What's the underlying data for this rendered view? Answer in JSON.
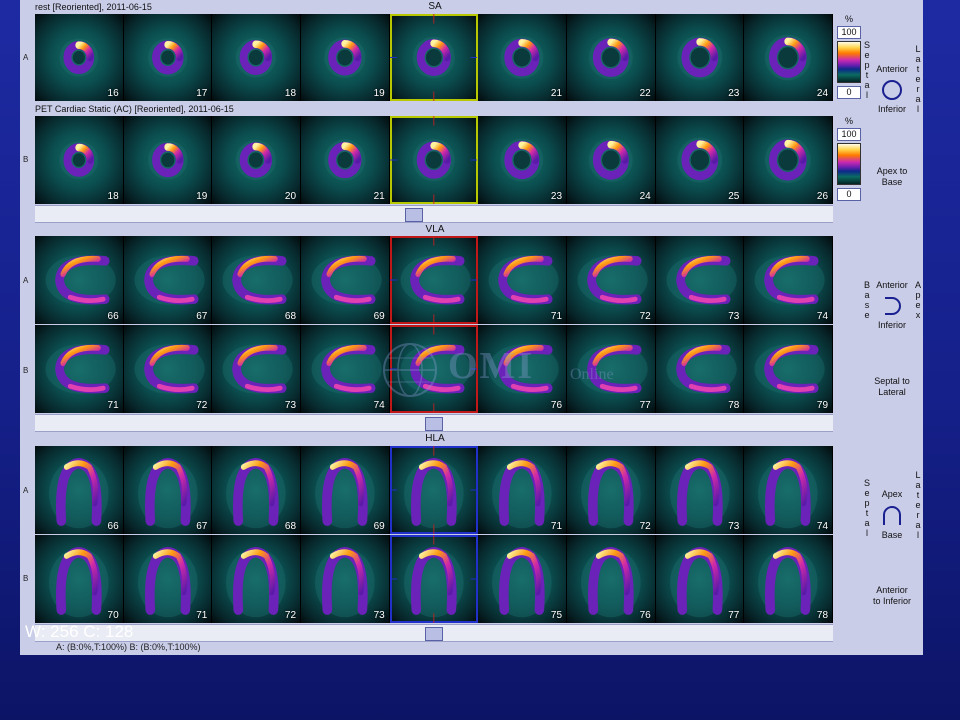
{
  "bands": [
    {
      "key": "sa",
      "title": "SA",
      "captions": [
        "rest [Reoriented], 2011-06-15",
        "PET Cardiac Static (AC) [Reoriented], 2011-06-15"
      ],
      "rows": [
        {
          "letter": "A",
          "frames": [
            "16",
            "17",
            "18",
            "19",
            "",
            "21",
            "22",
            "23",
            "24"
          ],
          "selected": 4,
          "sel": "y",
          "shape": "ring"
        },
        {
          "letter": "B",
          "frames": [
            "18",
            "19",
            "20",
            "21",
            "",
            "23",
            "24",
            "25",
            "26"
          ],
          "selected": 4,
          "sel": "y",
          "shape": "ring"
        }
      ]
    },
    {
      "key": "vla",
      "title": "VLA",
      "captions": [],
      "rows": [
        {
          "letter": "A",
          "frames": [
            "66",
            "67",
            "68",
            "69",
            "",
            "71",
            "72",
            "73",
            "74"
          ],
          "selected": 4,
          "sel": "r",
          "shape": "vla"
        },
        {
          "letter": "B",
          "frames": [
            "71",
            "72",
            "73",
            "74",
            "",
            "76",
            "77",
            "78",
            "79"
          ],
          "selected": 4,
          "sel": "r",
          "shape": "vla"
        }
      ]
    },
    {
      "key": "hla",
      "title": "HLA",
      "captions": [],
      "rows": [
        {
          "letter": "A",
          "frames": [
            "66",
            "67",
            "68",
            "69",
            "",
            "71",
            "72",
            "73",
            "74"
          ],
          "selected": 4,
          "sel": "b",
          "shape": "hla"
        },
        {
          "letter": "B",
          "frames": [
            "70",
            "71",
            "72",
            "73",
            "",
            "75",
            "76",
            "77",
            "78"
          ],
          "selected": 4,
          "sel": "b",
          "shape": "hla"
        }
      ]
    }
  ],
  "colorbar": {
    "unit": "%",
    "max": "100",
    "min": "0"
  },
  "orientation": {
    "sa": {
      "top": "Anterior",
      "bottom": "Inferior",
      "left": "Septal",
      "right": "Lateral",
      "axis": "Apex to Base"
    },
    "vla": {
      "top": "Anterior",
      "bottom": "Inferior",
      "left": "Base",
      "right": "Apex",
      "axis": "Septal to Lateral"
    },
    "hla": {
      "top": "Apex",
      "bottom": "Base",
      "left": "Septal",
      "right": "Lateral",
      "axis": "Anterior to Inferior"
    }
  },
  "readout": "W: 256  C: 128",
  "status": "A: (B:0%,T:100%)     B: (B:0%,T:100%)",
  "watermark": {
    "text": "OMI",
    "sub": "Online"
  },
  "colors": {
    "frame_bg": "#0b4e50",
    "sel_yellow": "#b8c800",
    "sel_red": "#c01818",
    "sel_blue": "#2030c8",
    "panel": "#c9cde8",
    "slide_bg": "#1d2aa2"
  },
  "icons": [
    "ring-orientation-icon",
    "arch-right-orientation-icon",
    "arch-up-orientation-icon"
  ]
}
